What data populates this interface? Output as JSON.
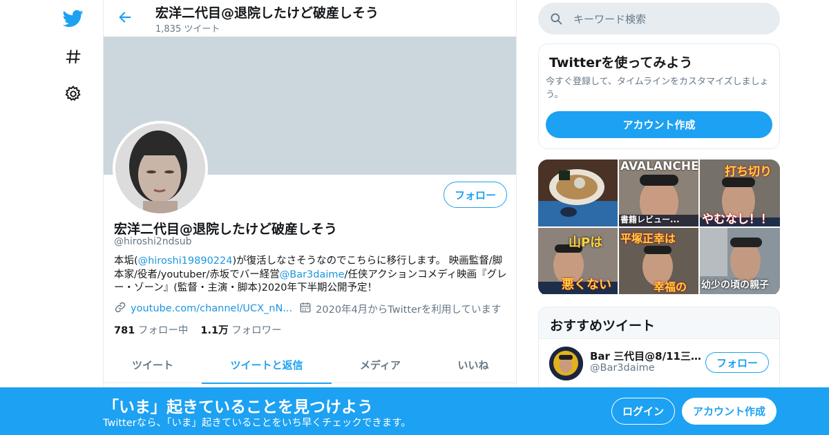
{
  "nav": {
    "logo_icon": "twitter-bird-icon",
    "explore_icon": "hashtag-icon",
    "settings_icon": "gear-icon"
  },
  "header": {
    "back_icon": "arrow-left-icon",
    "title": "宏洋二代目@退院したけど破産しそう",
    "tweet_count": "1,835 ツイート"
  },
  "profile": {
    "name": "宏洋二代目@退院したけど破産しそう",
    "handle": "@hiroshi2ndsub",
    "follow_label": "フォロー",
    "bio": {
      "part1": "本垢(",
      "mention1": "@hiroshi19890224",
      "part2": ")が復活しなさそうなのでこちらに移行します。 映画監督/脚本家/役者/youtuber/赤坂でバー経営",
      "mention2": "@Bar3daime",
      "part3": "/任侠アクションコメディ映画『グレー・ゾーン』(監督・主演・脚本)2020年下半期公開予定！"
    },
    "link_icon": "link-icon",
    "url": "youtube.com/channel/UCX_nN...",
    "calendar_icon": "calendar-icon",
    "joined": "2020年4月からTwitterを利用しています",
    "following_count": "781",
    "following_label": "フォロー中",
    "followers_count": "1.1万",
    "followers_label": "フォロワー"
  },
  "tabs": [
    {
      "label": "ツイート",
      "active": false
    },
    {
      "label": "ツイートと返信",
      "active": true
    },
    {
      "label": "メディア",
      "active": false
    },
    {
      "label": "いいね",
      "active": false
    }
  ],
  "search": {
    "icon": "search-icon",
    "placeholder": "キーワード検索"
  },
  "try_card": {
    "title": "Twitterを使ってみよう",
    "description": "今すぐ登録して、タイムラインをカスタマイズしましょう。",
    "button": "アカウント作成"
  },
  "media_grid": [
    {
      "caption": ""
    },
    {
      "caption": "AVALANCHE",
      "subcaption": "書籍レビュー..."
    },
    {
      "caption": "打ち切り",
      "subcaption": "やむなし！！"
    },
    {
      "caption": "山Pは",
      "subcaption": "悪くない"
    },
    {
      "caption": "平塚正幸は",
      "subcaption": "幸福の"
    },
    {
      "caption": "",
      "subcaption": "幼少の頃の親子"
    }
  ],
  "recommended": {
    "title": "おすすめツイート",
    "account": {
      "name": "Bar 三代目@8/11三谷...",
      "handle": "@Bar3daime",
      "follow_label": "フォロー"
    }
  },
  "bottom_bar": {
    "title": "「いま」起きていることを見つけよう",
    "subtitle": "Twitterなら、「いま」起きていることをいち早くチェックできます。",
    "login": "ログイン",
    "signup": "アカウント作成"
  },
  "colors": {
    "brand": "#1da1f2",
    "link": "#1b95e0",
    "secondary_text": "#657786",
    "banner": "#ccd6dd"
  }
}
